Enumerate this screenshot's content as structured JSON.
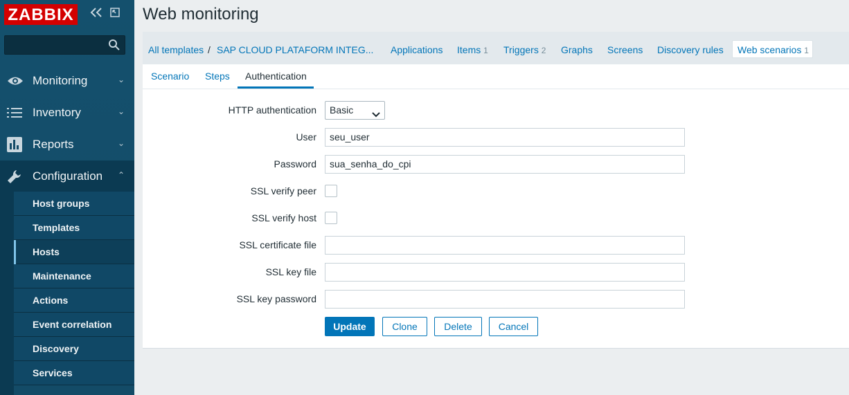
{
  "app": {
    "logo": "ZABBIX"
  },
  "sidebar": {
    "menu": [
      {
        "label": "Monitoring",
        "icon": "eye-icon"
      },
      {
        "label": "Inventory",
        "icon": "list-icon"
      },
      {
        "label": "Reports",
        "icon": "bar-chart-icon"
      },
      {
        "label": "Configuration",
        "icon": "wrench-icon"
      }
    ],
    "submenu": [
      "Host groups",
      "Templates",
      "Hosts",
      "Maintenance",
      "Actions",
      "Event correlation",
      "Discovery",
      "Services"
    ],
    "selected_submenu": "Hosts"
  },
  "header": {
    "title": "Web monitoring"
  },
  "nav": {
    "breadcrumb_root": "All templates",
    "separator": "/",
    "breadcrumb_template": "SAP CLOUD PLATAFORM INTEG...",
    "applications": "Applications",
    "items": "Items",
    "items_count": "1",
    "triggers": "Triggers",
    "triggers_count": "2",
    "graphs": "Graphs",
    "screens": "Screens",
    "discovery": "Discovery rules",
    "web": "Web scenarios",
    "web_count": "1"
  },
  "tabs": {
    "scenario": "Scenario",
    "steps": "Steps",
    "authentication": "Authentication"
  },
  "form": {
    "http_auth_label": "HTTP authentication",
    "http_auth_value": "Basic",
    "user_label": "User",
    "user_value": "seu_user",
    "password_label": "Password",
    "password_value": "sua_senha_do_cpi",
    "ssl_peer_label": "SSL verify peer",
    "ssl_host_label": "SSL verify host",
    "ssl_cert_label": "SSL certificate file",
    "ssl_key_label": "SSL key file",
    "ssl_key_pass_label": "SSL key password"
  },
  "buttons": {
    "update": "Update",
    "clone": "Clone",
    "delete": "Delete",
    "cancel": "Cancel"
  },
  "colors": {
    "sidebar": "#134b67",
    "logo": "#d40000",
    "link": "#0275b8"
  }
}
